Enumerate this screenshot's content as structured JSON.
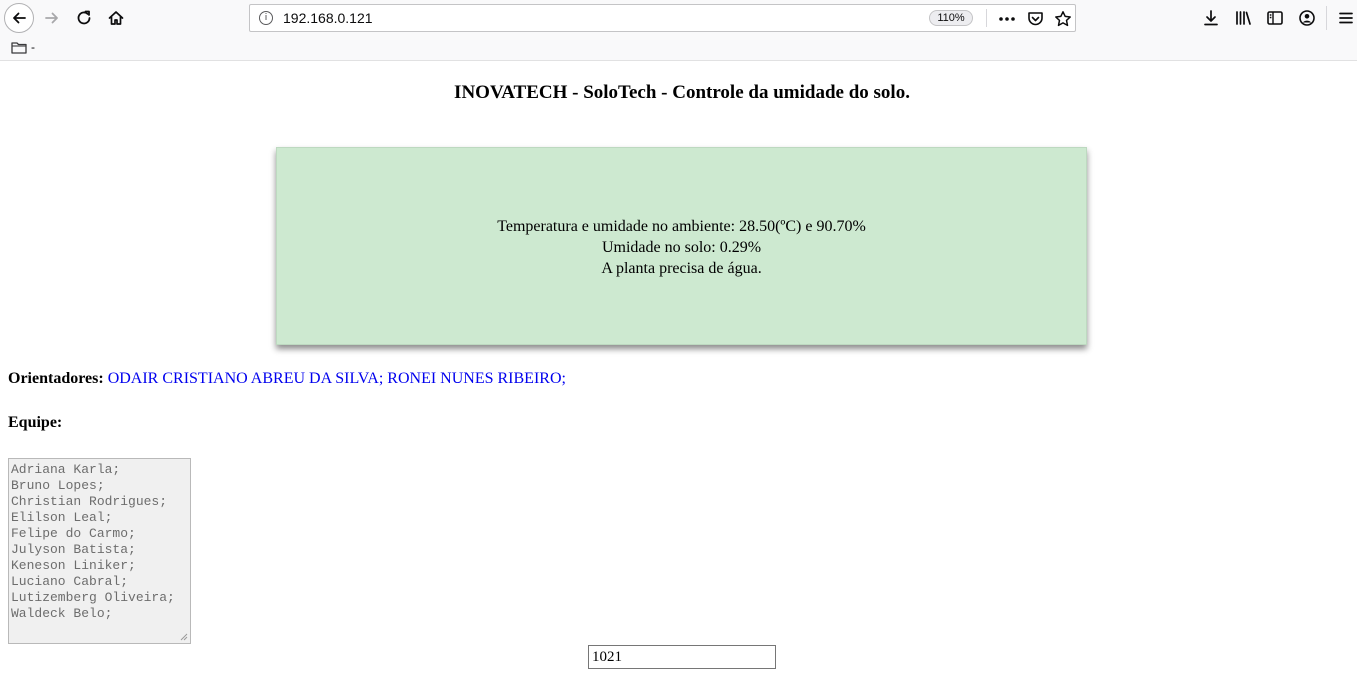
{
  "browser": {
    "url": "192.168.0.121",
    "zoom": "110%",
    "bookmark_label": "-",
    "icons": {
      "back": "back-arrow-icon",
      "forward": "forward-arrow-icon",
      "reload": "reload-icon",
      "home": "home-icon",
      "info": "site-info-icon",
      "page_actions": "more-actions-icon",
      "pocket": "pocket-icon",
      "bookmark_star": "bookmark-star-icon",
      "downloads": "download-icon",
      "library": "library-icon",
      "sidebar": "sidebar-icon",
      "account": "account-icon",
      "menu": "hamburger-menu-icon",
      "folder": "folder-icon"
    }
  },
  "page": {
    "title": "INOVATECH - SoloTech - Controle da umidade do solo.",
    "status": {
      "line1": "Temperatura e umidade no ambiente: 28.50(ºC) e 90.70%",
      "line2": "Umidade no solo: 0.29%",
      "line3": "A planta precisa de água.",
      "background": "#cde9d0"
    },
    "advisors": {
      "label": "Orientadores:",
      "names": "ODAIR CRISTIANO ABREU DA SILVA; RONEI NUNES RIBEIRO;",
      "color": "#0000ee"
    },
    "team": {
      "label": "Equipe:",
      "members": [
        "Adriana Karla;",
        "Bruno Lopes;",
        "Christian Rodrigues;",
        "Elilson Leal;",
        "Felipe do Carmo;",
        "Julyson Batista;",
        "Keneson Liniker;",
        "Luciano Cabral;",
        "Lutizemberg Oliveira;",
        "Waldeck Belo;"
      ]
    },
    "sensor_value": "1021"
  }
}
